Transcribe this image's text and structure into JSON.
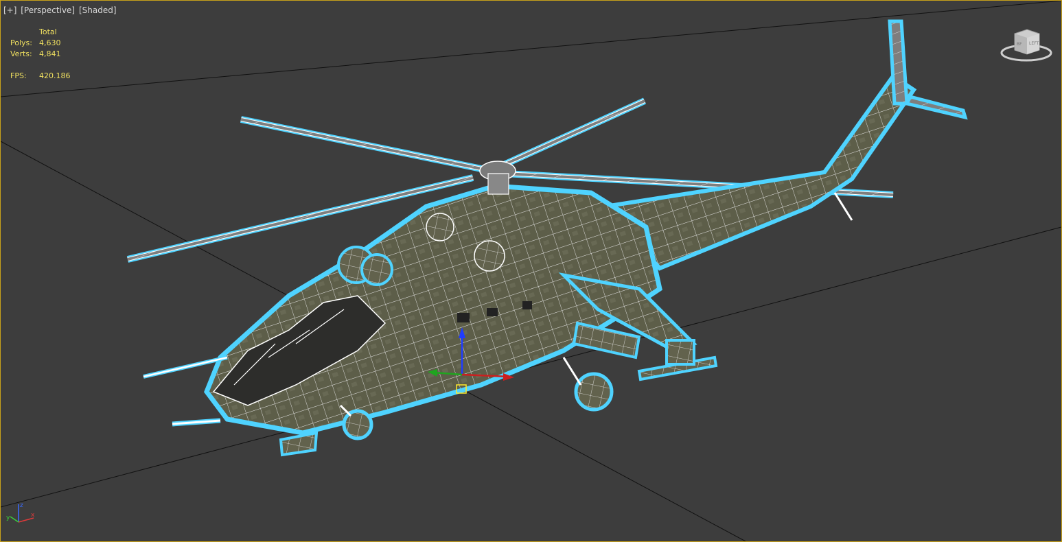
{
  "viewport": {
    "menu": {
      "plus": "[+]",
      "view": "[Perspective]",
      "shading": "[Shaded]"
    },
    "stats": {
      "header": "Total",
      "polys_label": "Polys:",
      "polys_value": "4,630",
      "verts_label": "Verts:",
      "verts_value": "4,841",
      "fps_label": "FPS:",
      "fps_value": "420.186"
    },
    "viewcube": {
      "icon": "viewcube-icon",
      "faces": [
        "BF",
        "LEFT"
      ]
    },
    "colors": {
      "viewport_border": "#c9a21a",
      "background": "#3d3d3d",
      "grid": "#111111",
      "selection_outline": "#4fd3ff",
      "wireframe": "#ffffff",
      "model_base": "#5f604a",
      "stats_text": "#f0e060"
    },
    "axis_labels": [
      "x",
      "y",
      "z"
    ]
  }
}
